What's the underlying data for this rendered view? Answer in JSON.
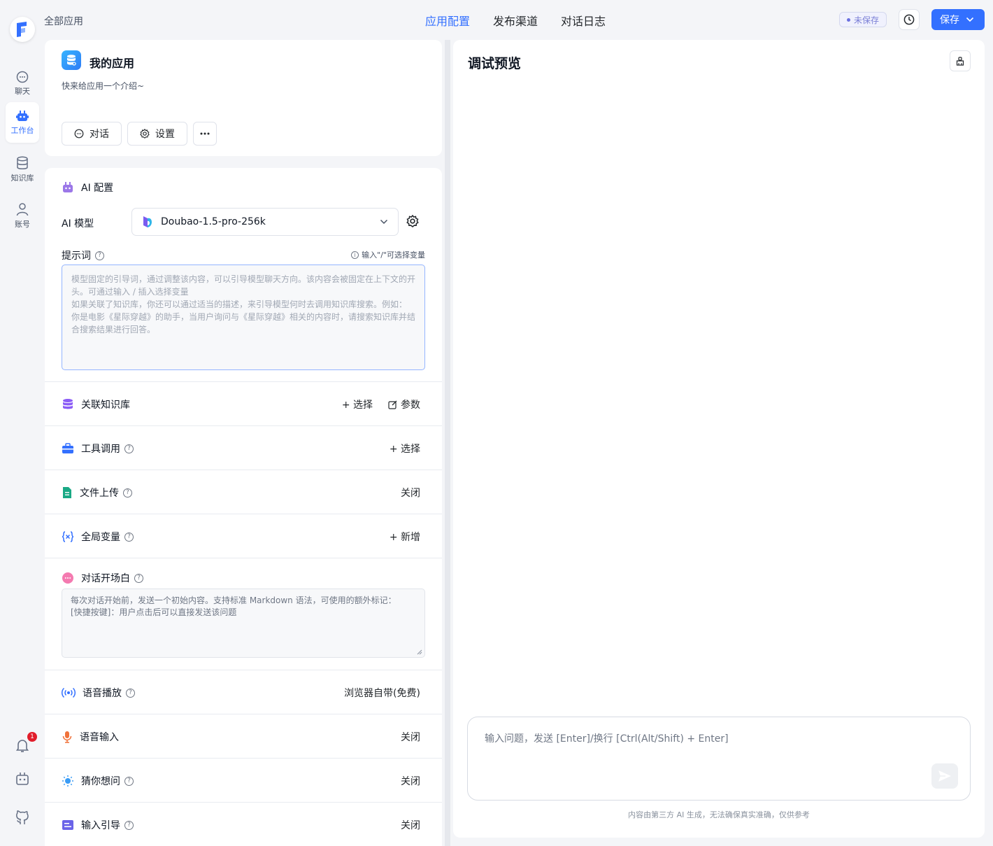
{
  "rail": {
    "items": [
      {
        "label": "聊天",
        "icon": "chat-icon"
      },
      {
        "label": "工作台",
        "icon": "robot-icon"
      },
      {
        "label": "知识库",
        "icon": "database-icon"
      },
      {
        "label": "账号",
        "icon": "user-icon"
      }
    ],
    "notification_count": "1"
  },
  "header": {
    "breadcrumb": "全部应用",
    "tabs": [
      {
        "label": "应用配置"
      },
      {
        "label": "发布渠道"
      },
      {
        "label": "对话日志"
      }
    ],
    "unsaved": "未保存",
    "save_label": "保存"
  },
  "app": {
    "name": "我的应用",
    "intro": "快来给应用一个介绍~",
    "chat_btn": "对话",
    "settings_btn": "设置"
  },
  "ai": {
    "title": "AI 配置",
    "model_label": "AI 模型",
    "model_value": "Doubao-1.5-pro-256k",
    "prompt_label": "提示词",
    "prompt_hint": "输入\"/\"可选择变量",
    "prompt_placeholder": [
      "模型固定的引导词，通过调整该内容，可以引导模型聊天方向。该内容会被固定在上下文的开",
      "头。可通过输入 / 插入选择变量",
      "如果关联了知识库，你还可以通过适当的描述，来引导模型何时去调用知识库搜索。例如：",
      "你是电影《星际穿越》的助手，当用户询问与《星际穿越》相关的内容时，请搜索知识库并结",
      "合搜索结果进行回答。"
    ]
  },
  "sections": {
    "kb": {
      "title": "关联知识库",
      "action1": "+ 选择",
      "action2": "参数"
    },
    "tools": {
      "title": "工具调用",
      "action": "+ 选择"
    },
    "file": {
      "title": "文件上传",
      "action": "关闭"
    },
    "vars": {
      "title": "全局变量",
      "action": "+ 新增"
    },
    "welcome": {
      "title": "对话开场白",
      "placeholder": [
        "每次对话开始前，发送一个初始内容。支持标准 Markdown 语法，可使用的额外标记：",
        "[快捷按键]：用户点击后可以直接发送该问题"
      ]
    },
    "tts": {
      "title": "语音播放",
      "action": "浏览器自带(免费)"
    },
    "stt": {
      "title": "语音输入",
      "action": "关闭"
    },
    "guess": {
      "title": "猜你想问",
      "action": "关闭"
    },
    "guide": {
      "title": "输入引导",
      "action": "关闭"
    }
  },
  "preview": {
    "title": "调试预览",
    "input_placeholder": "输入问题，发送 [Enter]/换行 [Ctrl(Alt/Shift) + Enter]",
    "disclaimer": "内容由第三方 AI 生成，无法确保真实准确，仅供参考"
  },
  "colors": {
    "accent": "#3370ff",
    "badge": "#e11d2b"
  }
}
